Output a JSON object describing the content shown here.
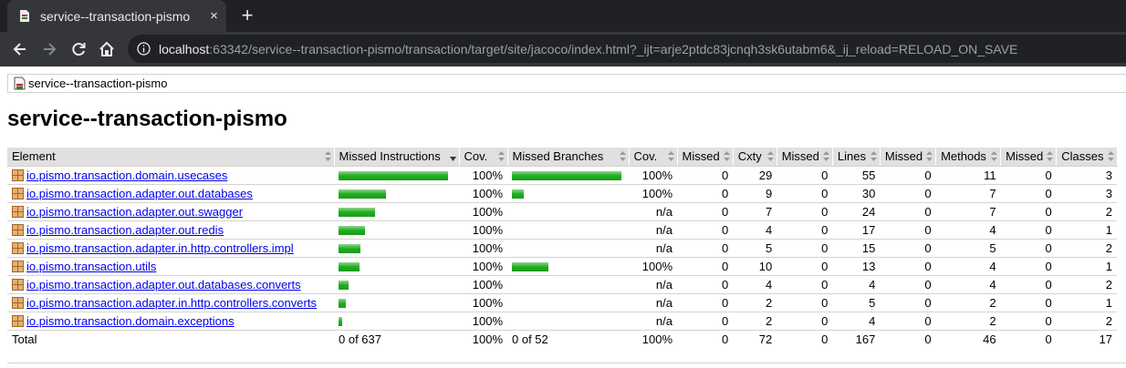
{
  "browser": {
    "tab_title": "service--transaction-pismo",
    "tab_close": "×",
    "new_tab": "+",
    "url_host": "localhost",
    "url_rest": ":63342/service--transaction-pismo/transaction/target/site/jacoco/index.html?_ijt=arje2ptdc83jcnqh3sk6utabm6&_ij_reload=RELOAD_ON_SAVE",
    "icons": [
      "back-icon",
      "forward-icon",
      "reload-icon",
      "home-icon",
      "info-icon"
    ]
  },
  "breadcrumb": {
    "label": "service--transaction-pismo"
  },
  "page": {
    "title": "service--transaction-pismo"
  },
  "table": {
    "headers": [
      "Element",
      "Missed Instructions",
      "Cov.",
      "Missed Branches",
      "Cov.",
      "Missed",
      "Cxty",
      "Missed",
      "Lines",
      "Missed",
      "Methods",
      "Missed",
      "Classes"
    ],
    "rows": [
      {
        "name": "io.pismo.transaction.domain.usecases",
        "instr_fraction": 1.0,
        "instr_cov": "100%",
        "branch_fraction": 1.0,
        "branch_cov": "100%",
        "missed_cxty": "0",
        "cxty": "29",
        "missed_lines": "0",
        "lines": "55",
        "missed_methods": "0",
        "methods": "11",
        "missed_classes": "0",
        "classes": "3"
      },
      {
        "name": "io.pismo.transaction.adapter.out.databases",
        "instr_fraction": 0.43,
        "instr_cov": "100%",
        "branch_fraction": 0.11,
        "branch_cov": "100%",
        "missed_cxty": "0",
        "cxty": "9",
        "missed_lines": "0",
        "lines": "30",
        "missed_methods": "0",
        "methods": "7",
        "missed_classes": "0",
        "classes": "3"
      },
      {
        "name": "io.pismo.transaction.adapter.out.swagger",
        "instr_fraction": 0.33,
        "instr_cov": "100%",
        "branch_fraction": 0,
        "branch_cov": "n/a",
        "missed_cxty": "0",
        "cxty": "7",
        "missed_lines": "0",
        "lines": "24",
        "missed_methods": "0",
        "methods": "7",
        "missed_classes": "0",
        "classes": "2"
      },
      {
        "name": "io.pismo.transaction.adapter.out.redis",
        "instr_fraction": 0.24,
        "instr_cov": "100%",
        "branch_fraction": 0,
        "branch_cov": "n/a",
        "missed_cxty": "0",
        "cxty": "4",
        "missed_lines": "0",
        "lines": "17",
        "missed_methods": "0",
        "methods": "4",
        "missed_classes": "0",
        "classes": "1"
      },
      {
        "name": "io.pismo.transaction.adapter.in.http.controllers.impl",
        "instr_fraction": 0.2,
        "instr_cov": "100%",
        "branch_fraction": 0,
        "branch_cov": "n/a",
        "missed_cxty": "0",
        "cxty": "5",
        "missed_lines": "0",
        "lines": "15",
        "missed_methods": "0",
        "methods": "5",
        "missed_classes": "0",
        "classes": "2"
      },
      {
        "name": "io.pismo.transaction.utils",
        "instr_fraction": 0.19,
        "instr_cov": "100%",
        "branch_fraction": 0.33,
        "branch_cov": "100%",
        "missed_cxty": "0",
        "cxty": "10",
        "missed_lines": "0",
        "lines": "13",
        "missed_methods": "0",
        "methods": "4",
        "missed_classes": "0",
        "classes": "1"
      },
      {
        "name": "io.pismo.transaction.adapter.out.databases.converts",
        "instr_fraction": 0.09,
        "instr_cov": "100%",
        "branch_fraction": 0,
        "branch_cov": "n/a",
        "missed_cxty": "0",
        "cxty": "4",
        "missed_lines": "0",
        "lines": "4",
        "missed_methods": "0",
        "methods": "4",
        "missed_classes": "0",
        "classes": "2"
      },
      {
        "name": "io.pismo.transaction.adapter.in.http.controllers.converts",
        "instr_fraction": 0.07,
        "instr_cov": "100%",
        "branch_fraction": 0,
        "branch_cov": "n/a",
        "missed_cxty": "0",
        "cxty": "2",
        "missed_lines": "0",
        "lines": "5",
        "missed_methods": "0",
        "methods": "2",
        "missed_classes": "0",
        "classes": "1"
      },
      {
        "name": "io.pismo.transaction.domain.exceptions",
        "instr_fraction": 0.03,
        "instr_cov": "100%",
        "branch_fraction": 0,
        "branch_cov": "n/a",
        "missed_cxty": "0",
        "cxty": "2",
        "missed_lines": "0",
        "lines": "4",
        "missed_methods": "0",
        "methods": "2",
        "missed_classes": "0",
        "classes": "2"
      }
    ],
    "total": {
      "label": "Total",
      "missed_instr": "0 of 637",
      "instr_cov": "100%",
      "missed_branches": "0 of 52",
      "branch_cov": "100%",
      "missed_cxty": "0",
      "cxty": "72",
      "missed_lines": "0",
      "lines": "167",
      "missed_methods": "0",
      "methods": "46",
      "missed_classes": "0",
      "classes": "17"
    }
  },
  "colors": {
    "bar_green": "#1fae1f",
    "header_bg": "#e0e0e0",
    "link": "#0000ee"
  }
}
